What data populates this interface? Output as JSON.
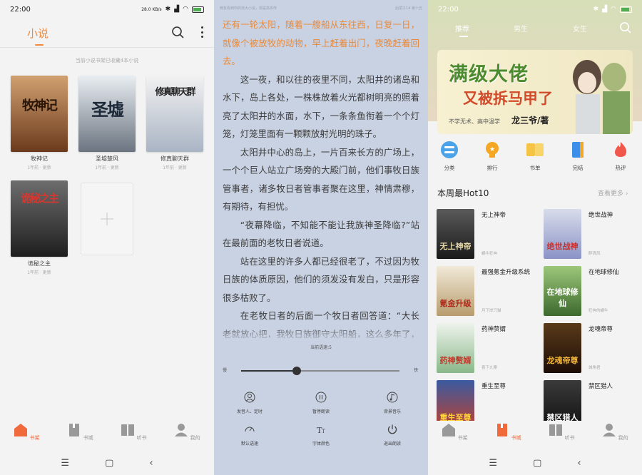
{
  "colors": {
    "accent": "#f08a3e",
    "nav_active": "#f06a3c",
    "reader_bg": "#c9d2e3"
  },
  "panel1": {
    "status": {
      "time": "22:00",
      "network": "28.0 KB/s"
    },
    "header_tab": "小说",
    "shelf_tip": "当前小说书架已收藏4本小说",
    "books": [
      {
        "name": "牧神记",
        "meta": "1年前 · 更新",
        "cover_text": "牧神记"
      },
      {
        "name": "圣墟楚风",
        "meta": "1年前 · 更新",
        "cover_text": "圣墟"
      },
      {
        "name": "修真聊天群",
        "meta": "1年前 · 更新",
        "cover_text": "修真聊天群"
      },
      {
        "name": "诡秘之主",
        "meta": "1年前 · 更新",
        "cover_text": "诡秘之主"
      }
    ],
    "nav": [
      {
        "label": "书架",
        "icon": "home-icon",
        "active": true
      },
      {
        "label": "书城",
        "icon": "book-icon",
        "active": false
      },
      {
        "label": "听书",
        "icon": "open-book-icon",
        "active": false
      },
      {
        "label": "我的",
        "icon": "person-icon",
        "active": false
      }
    ]
  },
  "panel2": {
    "top_left": "两友看到你的流大小说，现是高杀传",
    "top_right": "后把子14 第十五",
    "highlight": "还有一轮太阳，随着一艘船从东往西，日复一日，就像个被放牧的动物，早上赶着出门，夜晚赶着回去。",
    "paragraphs": [
      "这一夜，和以往的夜里不同，太阳井的诸岛和水下，岛上各处，一株株放着火光都树明亮的照着亮了太阳井的水面，水下，一条条鱼衔着一个个灯笼，灯笼里面有一颗颗放射光明的珠子。",
      "太阳井中心的岛上，一片百来长方的广场上，一个个巨人站立广场旁的大殿门前，他们事牧日族管事者，诸多牧日者管事者聚在这里，神情肃穆，有期待，有担忧。",
      "“夜幕降临，不知能不能让我族神圣降临?”站在最前面的老牧日者说道。",
      "站在这里的许多人都已经很老了，不过因为牧日族的体质原因，他们的须发没有发白，只是形容很多枯败了。",
      "在老牧日者的后面一个牧日者回答道：“大长老就放心把，我牧日族御守太阳船，这么多年了，传承千年一样，这一代一定的神能降临"
    ],
    "speed_label": "当前语速:5",
    "speed_value": 0.35,
    "slow_label": "慢",
    "fast_label": "快",
    "controls": [
      {
        "label": "发音人、定时",
        "icon": "person-circle-icon"
      },
      {
        "label": "暂停朗读",
        "icon": "pause-icon"
      },
      {
        "label": "背景音乐",
        "icon": "music-note-icon"
      },
      {
        "label": "默认语速",
        "icon": "speedometer-icon"
      },
      {
        "label": "字体颜色",
        "icon": "font-size-icon"
      },
      {
        "label": "退出朗读",
        "icon": "power-icon"
      }
    ]
  },
  "panel3": {
    "status": {
      "time": "22:00"
    },
    "tabs": [
      "推荐",
      "男生",
      "女生"
    ],
    "banner": {
      "title": "满级大佬",
      "subtitle": "又被拆马甲了",
      "tagline": "不学无术、高中温学",
      "author": "龙三爷/著"
    },
    "categories": [
      {
        "label": "分类",
        "icon": "category-icon",
        "color": "#4aa3e8"
      },
      {
        "label": "排行",
        "icon": "trophy-icon",
        "color": "#f5a623"
      },
      {
        "label": "书单",
        "icon": "booklist-icon",
        "color": "#f5c445"
      },
      {
        "label": "完结",
        "icon": "bookmark-book-icon",
        "color": "#3d8ee8"
      },
      {
        "label": "热评",
        "icon": "flame-icon",
        "color": "#f2574b"
      }
    ],
    "section_title": "本周最Hot10",
    "section_more": "查看更多 ›",
    "hot": [
      {
        "name": "无上神帝",
        "author": "蜗牛狂奔",
        "cover_text": "无上神帝"
      },
      {
        "name": "绝世战神",
        "author": "醉清风",
        "cover_text": "绝世战神"
      },
      {
        "name": "最强氪金升级系统",
        "author": "月下岸只猫",
        "cover_text": "氪金升级"
      },
      {
        "name": "在地球修仙",
        "author": "狂奔的蜗牛",
        "cover_text": "在地球修仙"
      },
      {
        "name": "药神赘婿",
        "author": "喜下九寨",
        "cover_text": "药神赘婿"
      },
      {
        "name": "龙魂帝尊",
        "author": "城角君",
        "cover_text": "龙魂帝尊"
      },
      {
        "name": "重生至尊",
        "author": "",
        "cover_text": "重生至尊"
      },
      {
        "name": "禁区猎人",
        "author": "",
        "cover_text": "禁区猎人"
      }
    ],
    "nav": [
      {
        "label": "书架",
        "icon": "home-icon",
        "active": false
      },
      {
        "label": "书城",
        "icon": "book-icon",
        "active": true
      },
      {
        "label": "听书",
        "icon": "open-book-icon",
        "active": false
      },
      {
        "label": "我的",
        "icon": "person-icon",
        "active": false
      }
    ]
  },
  "system_nav": {
    "menu": "☰",
    "home": "▢",
    "back": "‹"
  }
}
